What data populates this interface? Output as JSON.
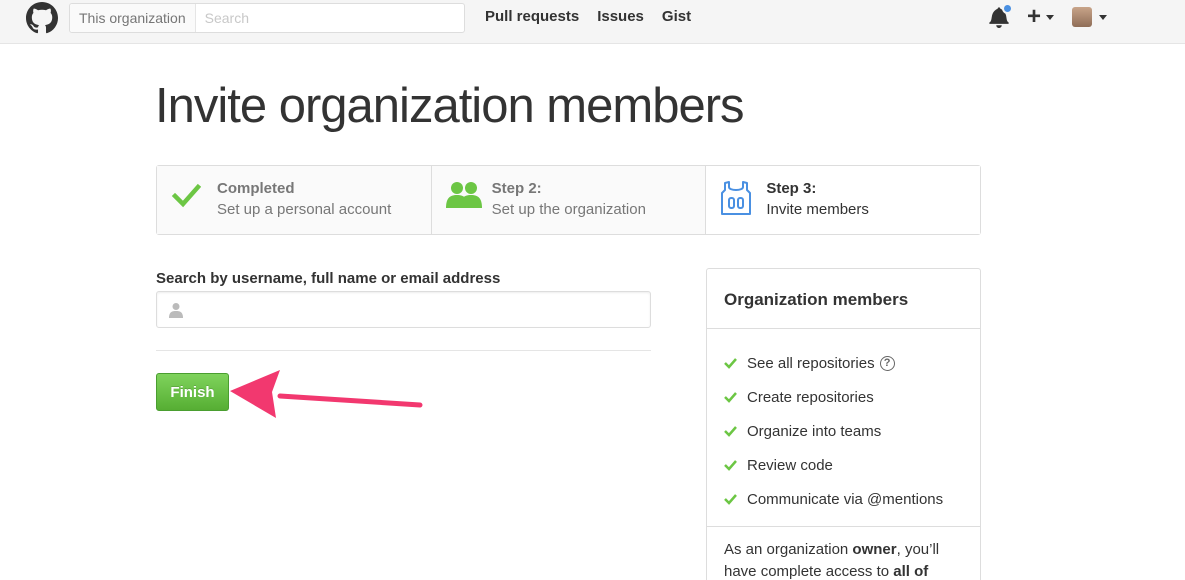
{
  "header": {
    "search_scope": "This organization",
    "search_placeholder": "Search",
    "nav": [
      "Pull requests",
      "Issues",
      "Gist"
    ],
    "icons": [
      "github-logo",
      "bell-icon",
      "plus-icon",
      "avatar"
    ]
  },
  "page_title": "Invite organization members",
  "steps": [
    {
      "title": "Completed",
      "desc": "Set up a personal account",
      "icon": "check-icon",
      "state": "complete"
    },
    {
      "title": "Step 2:",
      "desc": "Set up the organization",
      "icon": "people-icon",
      "state": "complete"
    },
    {
      "title": "Step 3:",
      "desc": "Invite members",
      "icon": "jersey-icon",
      "state": "current"
    }
  ],
  "form": {
    "search_label": "Search by username, full name or email address",
    "input_value": "",
    "finish_label": "Finish"
  },
  "sidebar": {
    "title": "Organization members",
    "permissions": [
      "See all repositories",
      "Create repositories",
      "Organize into teams",
      "Review code",
      "Communicate via @mentions"
    ],
    "owner_note_prefix": "As an organization ",
    "owner_note_bold": "owner",
    "owner_note_mid": ", you’ll have complete access to ",
    "owner_note_bold2": "all of"
  },
  "colors": {
    "accent_green": "#6cc644",
    "arrow_pink": "#f2386f",
    "notification_blue": "#4a90e2"
  }
}
